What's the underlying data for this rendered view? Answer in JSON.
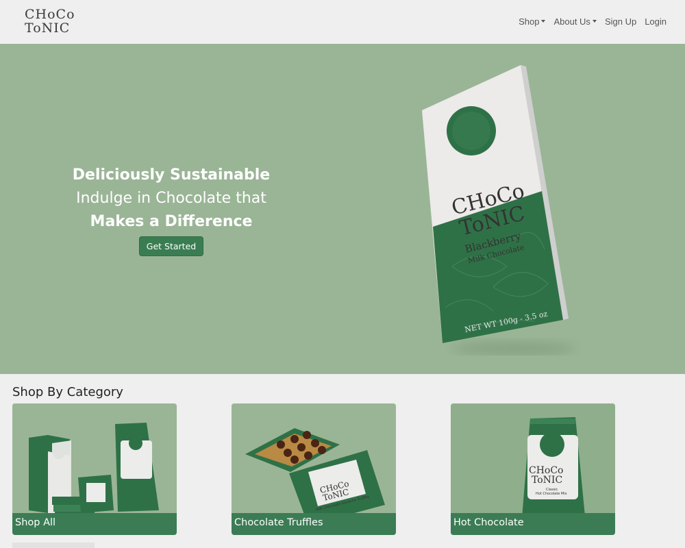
{
  "brand": {
    "logo_line1": "CHoCo",
    "logo_line2": "ToNIC"
  },
  "nav": {
    "items": [
      {
        "label": "Shop",
        "dropdown": true
      },
      {
        "label": "About Us",
        "dropdown": true
      },
      {
        "label": "Sign Up",
        "dropdown": false
      },
      {
        "label": "Login",
        "dropdown": false
      }
    ]
  },
  "hero": {
    "line1": "Deliciously Sustainable",
    "line2": "Indulge in Chocolate that",
    "line3": "Makes a Difference",
    "cta_label": "Get Started",
    "product": {
      "brand1": "CHoCo",
      "brand2": "ToNIC",
      "flavor": "Blackberry",
      "type": "Milk Chocolate",
      "weight": "NET WT 100g - 3.5 oz"
    }
  },
  "categories": {
    "title": "Shop By Category",
    "items": [
      {
        "label": "Shop All"
      },
      {
        "label": "Chocolate Truffles",
        "pack_text": "Milk Chocolate Ganache Truffles"
      },
      {
        "label": "Hot Chocolate",
        "pack_text1": "Classic",
        "pack_text2": "Hot Chocolate Mix"
      }
    ]
  },
  "colors": {
    "accent": "#3a7d52",
    "hero_bg": "#9ab596",
    "page_bg": "#efefef",
    "pack_green": "#2e6e45"
  }
}
